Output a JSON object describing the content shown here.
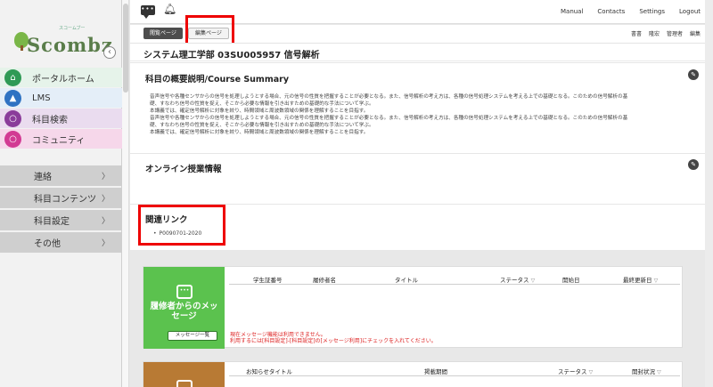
{
  "sidebar": {
    "logo_small": "スコームブー",
    "logo_text": "Scombz",
    "main_items": [
      {
        "label": "ポータルホーム",
        "icon": "home-icon"
      },
      {
        "label": "LMS",
        "icon": "graduation-cap-icon"
      },
      {
        "label": "科目検索",
        "icon": "magnifier-icon"
      },
      {
        "label": "コミュニティ",
        "icon": "magnifier-icon"
      }
    ],
    "sub_items": [
      {
        "label": "連絡"
      },
      {
        "label": "科目コンテンツ"
      },
      {
        "label": "科目設定"
      },
      {
        "label": "その他"
      }
    ],
    "chevron": "〉"
  },
  "header": {
    "links": [
      "Manual",
      "Contacts",
      "Settings",
      "Logout"
    ]
  },
  "subheader": {
    "view_tab": "閲覧ページ",
    "edit_tab": "編集ページ",
    "right_links": [
      "書書",
      "隆宏",
      "管理者",
      "編集"
    ]
  },
  "course": {
    "title": "システム理工学部 03SU005957 信号解析"
  },
  "summary": {
    "title": "科目の概要説明/Course Summary",
    "lines": [
      "音声信号や各種センサからの信号を処理しようとする場合、元の信号の性質を把握することが必要となる。また、信号解析の考え方は、各種の信号処理システムを考える上での基礎となる。このための信号解析の基",
      "礎、すなわち信号の性質を捉え、そこから必要な情報を引き出すための基礎的な手法について学ぶ。",
      "本講義では、確定信号解析に対象を絞り、時間領域と周波数領域の関係を理解することを目指す。",
      "音声信号や各種センサからの信号を処理しようとする場合、元の信号の性質を把握することが必要となる。また、信号解析の考え方は、各種の信号処理システムを考える上での基礎となる。このための信号解析の基",
      "礎、すなわち信号の性質を捉え、そこから必要な情報を引き出すための基礎的な手法について学ぶ。",
      "本講義では、確定信号解析に対象を絞り、時間領域と周波数領域の関係を理解することを目指す。"
    ]
  },
  "online": {
    "title": "オンライン授業情報"
  },
  "links": {
    "title": "関連リンク",
    "items": [
      "P0090701-2020"
    ]
  },
  "messages": {
    "tile_label": "履修者からのメッセージ",
    "tile_button": "メッセージ一覧",
    "columns": [
      "学生証番号",
      "履修者名",
      "タイトル",
      "ステータス",
      "開始日",
      "最終更新日"
    ],
    "sort_mark": "▽",
    "warning_lines": [
      "現在メッセージ機能は利用できません。",
      "利用するには[科目設定]-[科目設定]の[メッセージ利用]にチェックを入れてください。"
    ]
  },
  "notices": {
    "columns": [
      "お知らせタイトル",
      "掲載期間",
      "ステータス",
      "開封状況"
    ],
    "sort_mark": "▽"
  },
  "colors": {
    "message_tile": "#5bc24e",
    "notice_tile": "#b87a34",
    "highlight": "#ee0000",
    "warning": "#dd2222"
  }
}
